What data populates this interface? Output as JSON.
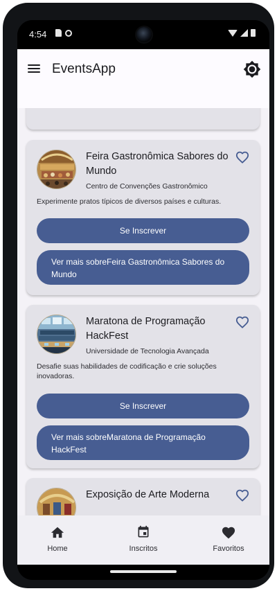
{
  "status": {
    "time": "4:54"
  },
  "app": {
    "title": "EventsApp"
  },
  "events": [
    {
      "title": "Feira Gastronômica Sabores do Mundo",
      "venue": "Centro de Convenções Gastronômico",
      "description": "Experimente pratos típicos de diversos países e culturas.",
      "subscribe_label": "Se Inscrever",
      "more_label": "Ver mais sobreFeira Gastronômica Sabores do Mundo"
    },
    {
      "title": "Maratona de Programação HackFest",
      "venue": "Universidade de Tecnologia Avançada",
      "description": "Desafie suas habilidades de codificação e crie soluções inovadoras.",
      "subscribe_label": "Se Inscrever",
      "more_label": "Ver mais sobreMaratona de Programação HackFest"
    },
    {
      "title": "Exposição de Arte Moderna"
    }
  ],
  "nav": {
    "home": "Home",
    "subscribed": "Inscritos",
    "favorites": "Favoritos"
  },
  "colors": {
    "primary": "#475d92",
    "card": "#e3e2e8",
    "background": "#f4f2f7",
    "appbar": "#fdfbff"
  },
  "icons": [
    "menu-icon",
    "brightness-icon",
    "heart-outline-icon",
    "home-icon",
    "calendar-icon",
    "heart-icon"
  ]
}
